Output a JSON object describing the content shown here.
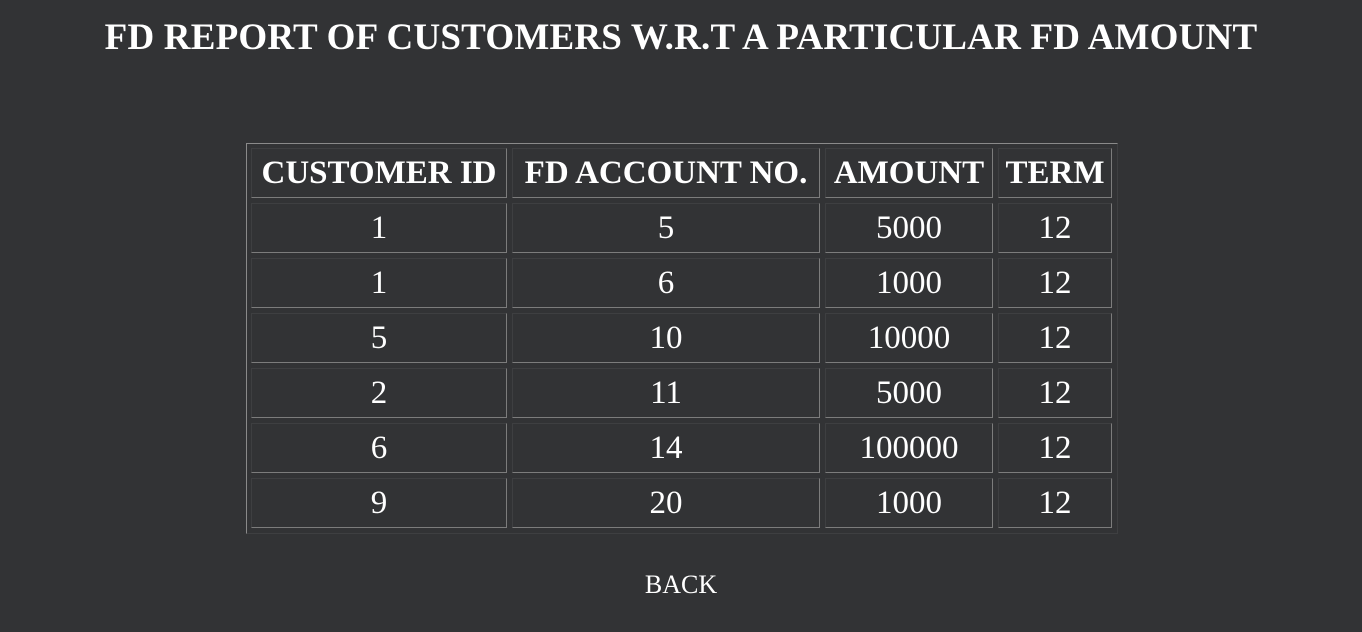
{
  "page": {
    "title": "FD REPORT OF CUSTOMERS W.R.T A PARTICULAR FD AMOUNT",
    "back_label": "BACK"
  },
  "colors": {
    "background": "#323335",
    "text": "#ffffff",
    "border": "#7c7c7c"
  },
  "table": {
    "headers": [
      "CUSTOMER ID",
      "FD ACCOUNT NO.",
      "AMOUNT",
      "TERM"
    ],
    "rows": [
      [
        "1",
        "5",
        "5000",
        "12"
      ],
      [
        "1",
        "6",
        "1000",
        "12"
      ],
      [
        "5",
        "10",
        "10000",
        "12"
      ],
      [
        "2",
        "11",
        "5000",
        "12"
      ],
      [
        "6",
        "14",
        "100000",
        "12"
      ],
      [
        "9",
        "20",
        "1000",
        "12"
      ]
    ]
  }
}
